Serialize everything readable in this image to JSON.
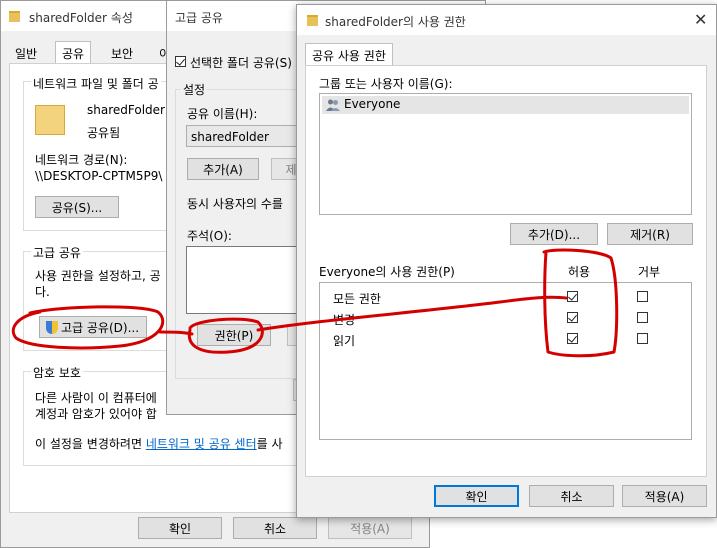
{
  "props_window": {
    "title": "sharedFolder 속성",
    "tabs": [
      "일반",
      "공유",
      "보안",
      "이"
    ],
    "net_share_group": "네트워크 파일 및 폴더 공",
    "folder_name": "sharedFolder",
    "folder_status": "공유됨",
    "net_path_label": "네트워크 경로(N):",
    "net_path_value": "\\\\DESKTOP-CPTM5P9\\",
    "share_button": "공유(S)...",
    "adv_group": "고급 공유",
    "adv_text_1": "사용 권한을 설정하고, 공",
    "adv_text_2": "다.",
    "adv_share_button": "고급 공유(D)...",
    "pwd_group": "암호 보호",
    "pwd_text_1": "다른 사람이 이 컴퓨터에",
    "pwd_text_2": "계정과 암호가 있어야 합",
    "pwd_text_3": "이 설정을 변경하려면",
    "pwd_link": "네트워크 및 공유 센터",
    "pwd_text_4": "를 사",
    "ok_button": "확인",
    "cancel_button": "취소",
    "apply_button": "적용(A)"
  },
  "adv_window": {
    "title": "고급 공유",
    "share_checkbox_label": "선택한 폴더 공유(S)",
    "settings_group": "설정",
    "share_name_label": "공유 이름(H):",
    "share_name_value": "sharedFolder",
    "add_button": "추가(A)",
    "remove_button": "제",
    "users_label": "동시 사용자의 수를",
    "comment_label": "주석(O):",
    "permissions_button": "권한(P)"
  },
  "perm_window": {
    "title": "sharedFolder의 사용 권한",
    "tab": "공유 사용 권한",
    "group_label": "그룹 또는 사용자 이름(G):",
    "users": [
      "Everyone"
    ],
    "add_button": "추가(D)...",
    "remove_button": "제거(R)",
    "perm_label": "Everyone의 사용 권한(P)",
    "allow_header": "허용",
    "deny_header": "거부",
    "permissions": [
      {
        "name": "모든 권한",
        "allow": true,
        "deny": false
      },
      {
        "name": "변경",
        "allow": true,
        "deny": false
      },
      {
        "name": "읽기",
        "allow": true,
        "deny": false
      }
    ],
    "ok_button": "확인",
    "cancel_button": "취소",
    "apply_button": "적용(A)"
  },
  "annotation_color": "#d40000"
}
